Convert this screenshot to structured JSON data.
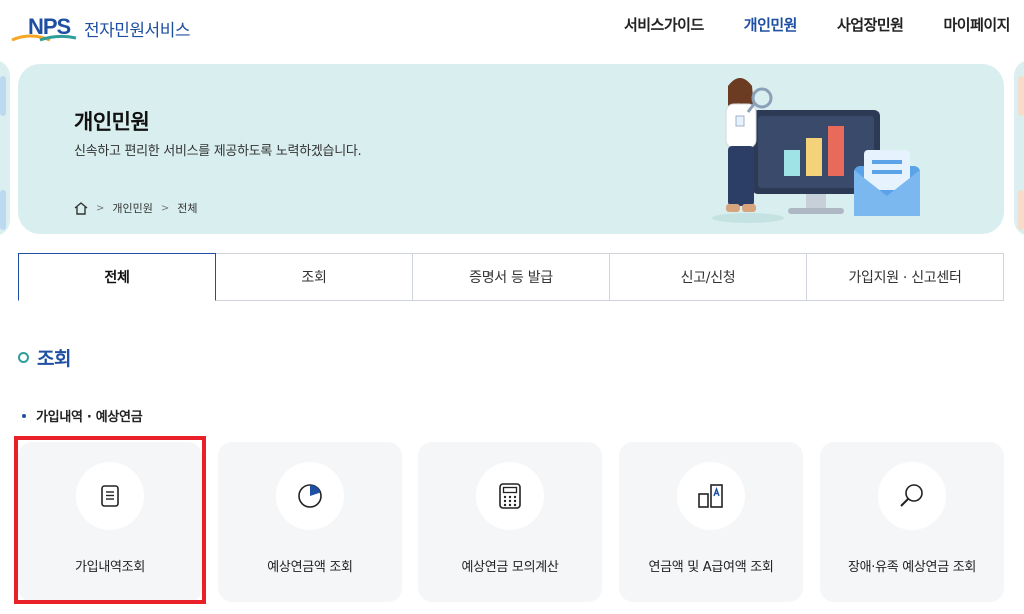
{
  "header": {
    "logo_mark": "NPS",
    "logo_text": "전자민원서비스",
    "nav": [
      {
        "label": "서비스가이드",
        "active": false
      },
      {
        "label": "개인민원",
        "active": true
      },
      {
        "label": "사업장민원",
        "active": false
      },
      {
        "label": "마이페이지",
        "active": false
      }
    ]
  },
  "banner": {
    "title": "개인민원",
    "subtitle": "신속하고 편리한 서비스를 제공하도록 노력하겠습니다.",
    "breadcrumb": [
      "개인민원",
      "전체"
    ]
  },
  "tabs": [
    {
      "label": "전체",
      "active": true
    },
    {
      "label": "조회",
      "active": false
    },
    {
      "label": "증명서 등 발급",
      "active": false
    },
    {
      "label": "신고/신청",
      "active": false
    },
    {
      "label": "가입지원 · 신고센터",
      "active": false
    }
  ],
  "section": {
    "title": "조회",
    "subsection": "가입내역 · 예상연금",
    "cards": [
      {
        "label": "가입내역조회",
        "icon": "document-icon"
      },
      {
        "label": "예상연금액 조회",
        "icon": "pie-chart-icon"
      },
      {
        "label": "예상연금 모의계산",
        "icon": "calculator-icon"
      },
      {
        "label": "연금액 및 A급여액 조회",
        "icon": "bar-compare-icon"
      },
      {
        "label": "장애·유족 예상연금 조회",
        "icon": "magnifier-icon"
      }
    ]
  },
  "colors": {
    "brand": "#1f4fa3",
    "banner_bg": "#d9eeee",
    "card_bg": "#f5f6f8",
    "highlight": "#e8202a",
    "accent_teal": "#2f9e9a"
  }
}
